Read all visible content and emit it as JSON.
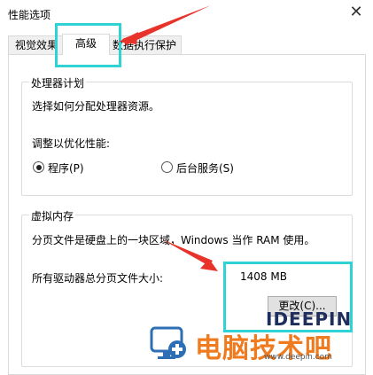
{
  "window": {
    "title": "性能选项"
  },
  "tabs": [
    {
      "label": "视觉效果"
    },
    {
      "label": "高级"
    },
    {
      "label": "数据执行保护"
    }
  ],
  "processor": {
    "legend": "处理器计划",
    "description": "选择如何分配处理器资源。",
    "optimize_label": "调整以优化性能:",
    "options": [
      {
        "label": "程序(P)",
        "checked": true
      },
      {
        "label": "后台服务(S)",
        "checked": false
      }
    ]
  },
  "virtual_memory": {
    "legend": "虚拟内存",
    "description": "分页文件是硬盘上的一块区域，Windows 当作 RAM 使用。",
    "total_label": "所有驱动器总分页文件大小:",
    "total_value": "1408 MB",
    "change_button": "更改(C)..."
  },
  "watermark": {
    "brand": "IDEEPIN",
    "text": "电脑技术吧",
    "sub": "www.deepin.com"
  },
  "colors": {
    "highlight": "#2fd3d3",
    "arrow": "#e8332a",
    "watermark_orange": "#f07a1e"
  }
}
